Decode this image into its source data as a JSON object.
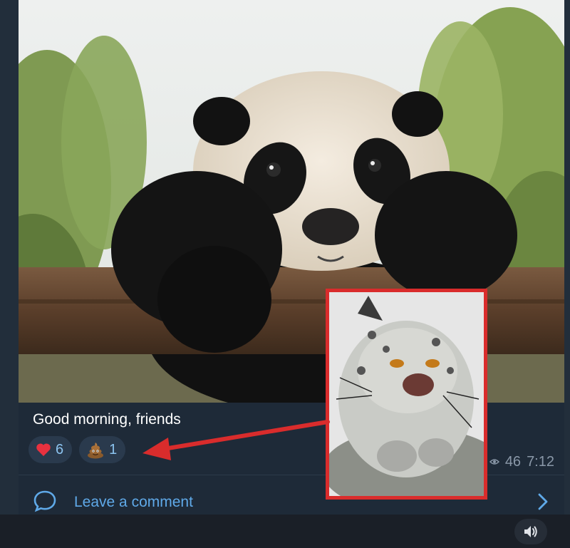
{
  "post": {
    "caption": "Good morning, friends",
    "reactions": [
      {
        "icon": "heart-icon",
        "count": "6"
      },
      {
        "icon": "poop-emoji-icon",
        "count": "1"
      }
    ],
    "views": "46",
    "time": "7:12",
    "comment_label": "Leave a comment"
  },
  "colors": {
    "accent": "#5fa9e8",
    "reaction_count": "#8cc4f0",
    "annotation_red": "#d92c2c",
    "card_bg": "#1e2a38"
  }
}
